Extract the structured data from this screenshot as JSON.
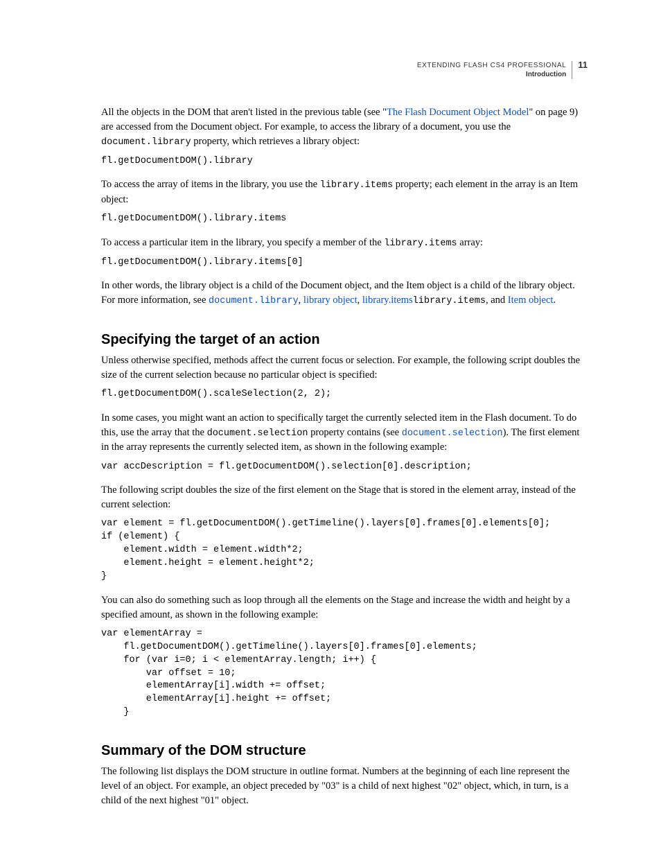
{
  "header": {
    "book": "EXTENDING FLASH CS4 PROFESSIONAL",
    "chapter": "Introduction",
    "page": "11"
  },
  "p1_a": "All the objects in the DOM that aren't listed in the previous table (see \"",
  "p1_link": "The Flash Document Object Model",
  "p1_b": "\" on page 9) are accessed from the Document object. For example, to access the library of a document, you use the ",
  "p1_code": "document.library",
  "p1_c": " property, which retrieves a library object:",
  "code1": "fl.getDocumentDOM().library",
  "p2_a": "To access the array of items in the library, you use the ",
  "p2_code": "library.items",
  "p2_b": "  property; each element in the array is an Item object:",
  "code2": "fl.getDocumentDOM().library.items",
  "p3_a": "To access a particular item in the library, you specify a member of the ",
  "p3_code": "library.items",
  "p3_b": " array:",
  "code3": "fl.getDocumentDOM().library.items[0]",
  "p4_a": "In other words, the library object is a child of the Document object, and the Item object is a child of the library object. For more information, see ",
  "p4_link1": "document.library",
  "p4_sep1": ", ",
  "p4_link2": "library object",
  "p4_sep2": ", ",
  "p4_link3": "library.items",
  "p4_code": "library.items",
  "p4_sep3": ", and ",
  "p4_link4": "Item object",
  "p4_end": ".",
  "h1": "Specifying the target of an action",
  "p5": "Unless otherwise specified, methods affect the current focus or selection. For example, the following script doubles the size of the current selection because no particular object is specified:",
  "code4": "fl.getDocumentDOM().scaleSelection(2, 2);",
  "p6_a": "In some cases, you might want an action to specifically target the currently selected item in the Flash document. To do this, use the array that the ",
  "p6_code": "document.selection",
  "p6_b": " property contains (see ",
  "p6_link": "document.selection",
  "p6_c": "). The first element in the array represents the currently selected item, as shown in the following example:",
  "code5": "var accDescription = fl.getDocumentDOM().selection[0].description;",
  "p7": "The following script doubles the size of the first element on the Stage that is stored in the element array, instead of the current selection:",
  "code6": "var element = fl.getDocumentDOM().getTimeline().layers[0].frames[0].elements[0];\nif (element) {\n    element.width = element.width*2;\n    element.height = element.height*2;\n}",
  "p8": "You can also do something such as loop through all the elements on the Stage and increase the width and height by a specified amount, as shown in the following example:",
  "code7": "var elementArray =\n    fl.getDocumentDOM().getTimeline().layers[0].frames[0].elements;\n    for (var i=0; i < elementArray.length; i++) {\n        var offset = 10;\n        elementArray[i].width += offset;\n        elementArray[i].height += offset;\n    }",
  "h2": "Summary of the DOM structure",
  "p9": "The following list displays the DOM structure in outline format. Numbers at the beginning of each line represent the level of an object. For example, an object preceded by \"03\" is a child of next highest \"02\" object, which, in turn, is a child of the next highest \"01\" object."
}
